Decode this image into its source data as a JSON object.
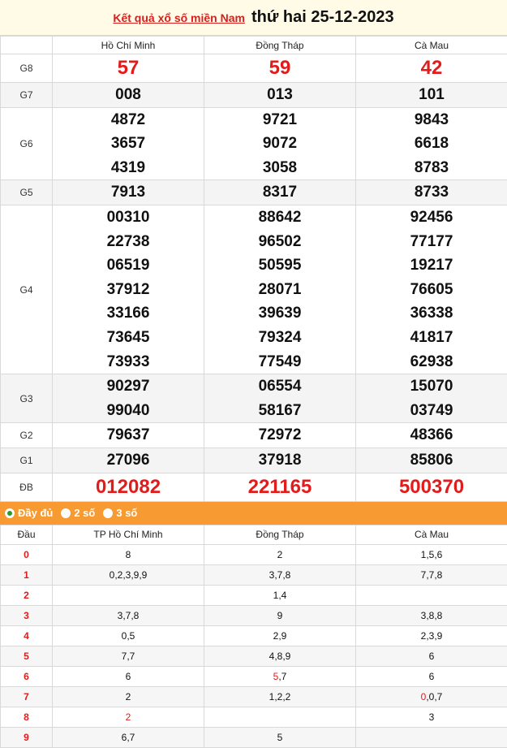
{
  "header": {
    "link_text": "Kết quả xổ số miền Nam",
    "date_text": "thứ hai 25-12-2023"
  },
  "provinces": [
    "Hồ Chí Minh",
    "Đồng Tháp",
    "Cà Mau"
  ],
  "prizes": [
    {
      "label": "G8",
      "values": [
        [
          "57"
        ],
        [
          "59"
        ],
        [
          "42"
        ]
      ]
    },
    {
      "label": "G7",
      "values": [
        [
          "008"
        ],
        [
          "013"
        ],
        [
          "101"
        ]
      ]
    },
    {
      "label": "G6",
      "values": [
        [
          "4872",
          "3657",
          "4319"
        ],
        [
          "9721",
          "9072",
          "3058"
        ],
        [
          "9843",
          "6618",
          "8783"
        ]
      ]
    },
    {
      "label": "G5",
      "values": [
        [
          "7913"
        ],
        [
          "8317"
        ],
        [
          "8733"
        ]
      ]
    },
    {
      "label": "G4",
      "values": [
        [
          "00310",
          "22738",
          "06519",
          "37912",
          "33166",
          "73645",
          "73933"
        ],
        [
          "88642",
          "96502",
          "50595",
          "28071",
          "39639",
          "79324",
          "77549"
        ],
        [
          "92456",
          "77177",
          "19217",
          "76605",
          "36338",
          "41817",
          "62938"
        ]
      ]
    },
    {
      "label": "G3",
      "values": [
        [
          "90297",
          "99040"
        ],
        [
          "06554",
          "58167"
        ],
        [
          "15070",
          "03749"
        ]
      ]
    },
    {
      "label": "G2",
      "values": [
        [
          "79637"
        ],
        [
          "72972"
        ],
        [
          "48366"
        ]
      ]
    },
    {
      "label": "G1",
      "values": [
        [
          "27096"
        ],
        [
          "37918"
        ],
        [
          "85806"
        ]
      ]
    },
    {
      "label": "ĐB",
      "values": [
        [
          "012082"
        ],
        [
          "221165"
        ],
        [
          "500370"
        ]
      ]
    }
  ],
  "tabs": [
    {
      "label": "Đầy đủ",
      "selected": true
    },
    {
      "label": "2 số",
      "selected": false
    },
    {
      "label": "3 số",
      "selected": false
    }
  ],
  "dau_table": {
    "headers": [
      "Đầu",
      "TP Hồ Chí Minh",
      "Đồng Tháp",
      "Cà Mau"
    ],
    "rows": [
      {
        "dau": "0",
        "cells": [
          [
            "8"
          ],
          [
            "2"
          ],
          [
            "1,5,6"
          ]
        ]
      },
      {
        "dau": "1",
        "cells": [
          [
            "0,2,3,9,9"
          ],
          [
            "3,7,8"
          ],
          [
            "7,7,8"
          ]
        ]
      },
      {
        "dau": "2",
        "cells": [
          [
            ""
          ],
          [
            "1,4"
          ],
          [
            ""
          ]
        ]
      },
      {
        "dau": "3",
        "cells": [
          [
            "3,7,8"
          ],
          [
            "9"
          ],
          [
            "3,8,8"
          ]
        ]
      },
      {
        "dau": "4",
        "cells": [
          [
            "0,5"
          ],
          [
            "2,9"
          ],
          [
            "2,3,9"
          ]
        ]
      },
      {
        "dau": "5",
        "cells": [
          [
            "7,7"
          ],
          [
            "4,8,9"
          ],
          [
            "6"
          ]
        ]
      },
      {
        "dau": "6",
        "cells": [
          [
            "6"
          ],
          [
            "5",
            ",7"
          ],
          [
            "6"
          ]
        ]
      },
      {
        "dau": "7",
        "cells": [
          [
            "2"
          ],
          [
            "1,2,2"
          ],
          [
            "0",
            ",0,7"
          ]
        ]
      },
      {
        "dau": "8",
        "cells": [
          [
            "2"
          ],
          [
            ""
          ],
          [
            "3"
          ]
        ]
      },
      {
        "dau": "9",
        "cells": [
          [
            "6,7"
          ],
          [
            "5"
          ],
          [
            ""
          ]
        ]
      }
    ],
    "highlight": {
      "6-1": true,
      "7-2": true,
      "8-0": true
    }
  }
}
